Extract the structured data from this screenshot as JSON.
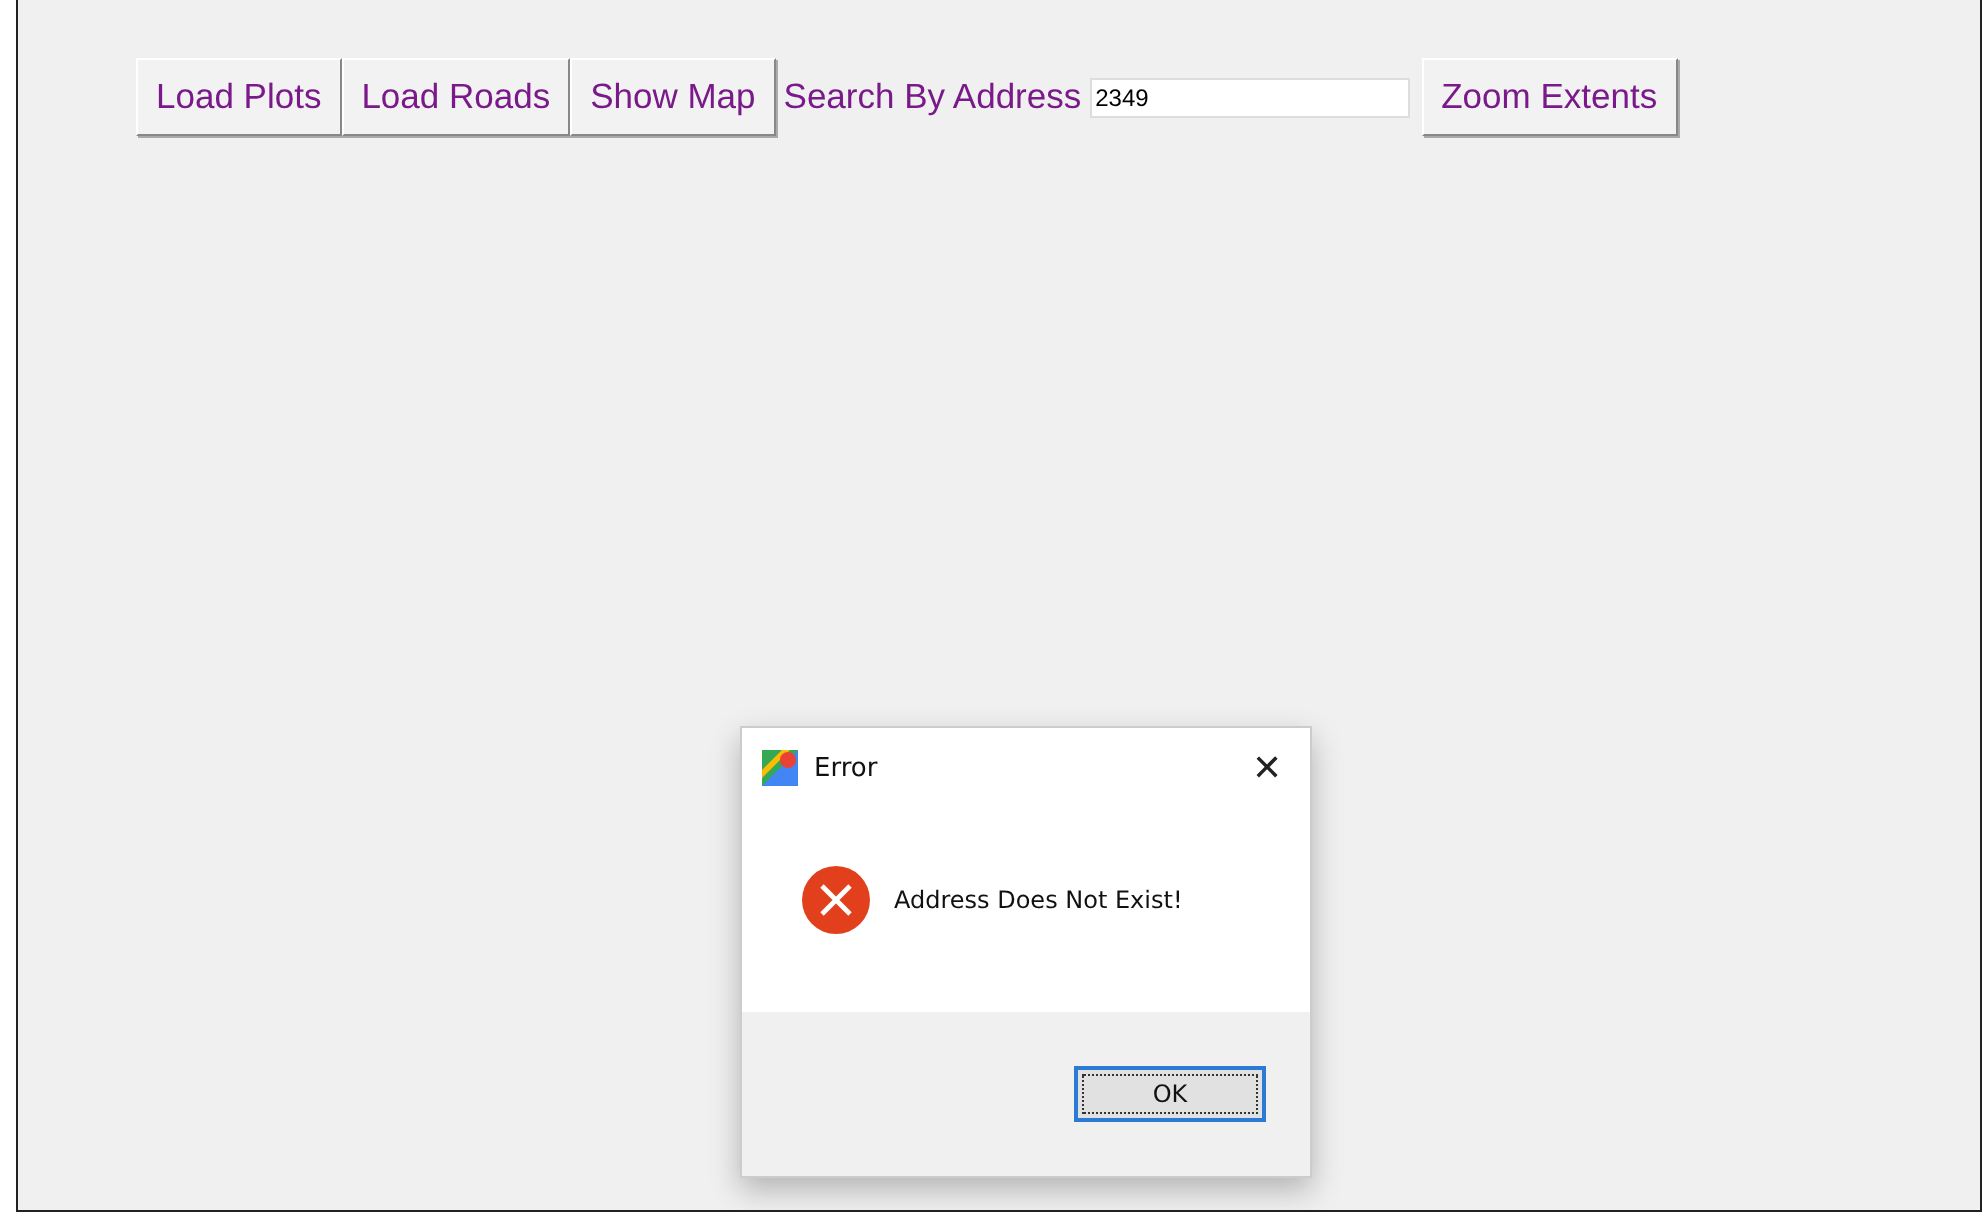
{
  "toolbar": [
    {
      "kind": "button",
      "label": "Load Plots"
    },
    {
      "kind": "button",
      "label": "Load Roads"
    },
    {
      "kind": "button",
      "label": "Show Map"
    },
    {
      "kind": "label",
      "label": "Search By Address"
    },
    {
      "kind": "field",
      "value": "2349"
    },
    {
      "kind": "button",
      "label": "Zoom Extents"
    }
  ],
  "dialog": {
    "title": "Error",
    "close": "✕",
    "message": "Address Does Not Exist!",
    "buttons": [
      "OK"
    ]
  }
}
